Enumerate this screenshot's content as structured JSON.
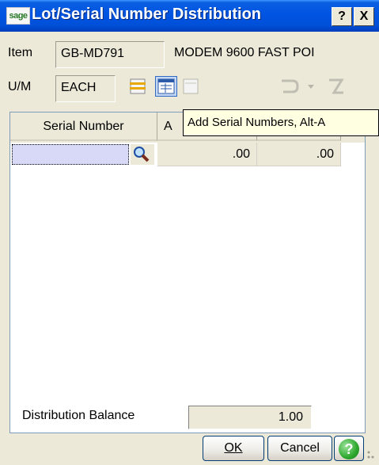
{
  "window": {
    "logo_text": "sage",
    "title": "Lot/Serial Number Distribution",
    "help_label": "?",
    "close_label": "X"
  },
  "header": {
    "item_label": "Item",
    "item_value": "GB-MD791",
    "item_description": "MODEM 9600 FAST POI",
    "um_label": "U/M",
    "um_value": "EACH"
  },
  "toolbar": {
    "icons": [
      "list-icon",
      "add-serial-numbers-icon",
      "blank-icon",
      "undo-icon",
      "dropdown-arrow-icon",
      "delete-icon"
    ]
  },
  "grid": {
    "columns": [
      "Serial Number",
      "A",
      ""
    ],
    "rows": [
      {
        "serial": "",
        "col2": ".00",
        "col3": ".00"
      }
    ]
  },
  "tooltip": {
    "text": "Add Serial Numbers, Alt-A"
  },
  "footer": {
    "balance_label": "Distribution Balance",
    "balance_value": "1.00",
    "ok_label": "OK",
    "cancel_label": "Cancel"
  },
  "colors": {
    "titlebar": "#0054e3",
    "dialog_bg": "#ece9d8",
    "tooltip_bg": "#ffffe1",
    "serial_input_bg": "#d8d8f7"
  }
}
